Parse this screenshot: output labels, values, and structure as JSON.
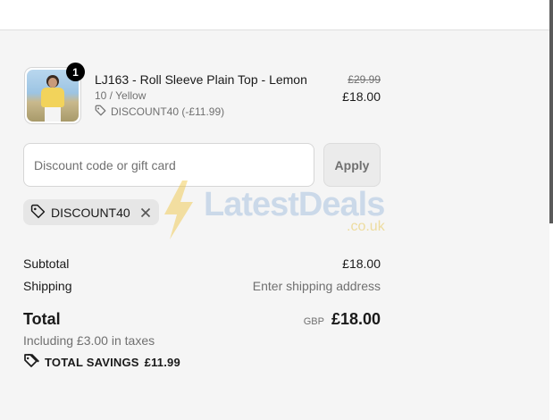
{
  "product": {
    "name": "LJ163 - Roll Sleeve Plain Top - Lemon",
    "variant": "10 / Yellow",
    "discount_line": "DISCOUNT40 (-£11.99)",
    "quantity": "1",
    "original_price": "£29.99",
    "price": "£18.00"
  },
  "discount": {
    "placeholder": "Discount code or gift card",
    "value": "",
    "apply_label": "Apply",
    "applied_code": "DISCOUNT40"
  },
  "watermark": {
    "text": "LatestDeals",
    "sub": ".co.uk"
  },
  "summary": {
    "subtotal_label": "Subtotal",
    "subtotal_value": "£18.00",
    "shipping_label": "Shipping",
    "shipping_value": "Enter shipping address",
    "total_label": "Total",
    "currency": "GBP",
    "total_value": "£18.00",
    "taxes": "Including £3.00 in taxes",
    "savings_label": "TOTAL SAVINGS",
    "savings_value": "£11.99"
  },
  "icons": {
    "tag": "tag-icon",
    "close": "close-icon",
    "savings": "savings-tag-icon"
  }
}
